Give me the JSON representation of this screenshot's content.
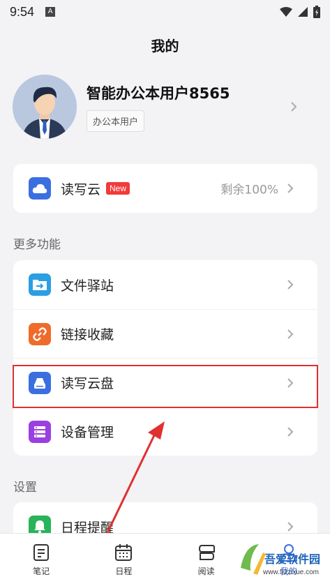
{
  "status_bar": {
    "time": "9:54",
    "notif_glyph": "A"
  },
  "header": {
    "title": "我的"
  },
  "profile": {
    "name": "智能办公本用户8565",
    "tag": "办公本用户"
  },
  "cloud_card": {
    "label": "读写云",
    "badge": "New",
    "value": "剩余100%"
  },
  "more_section": {
    "title": "更多功能",
    "items": [
      {
        "label": "文件驿站",
        "icon": "file-transfer-icon",
        "color": "#2a9fe3"
      },
      {
        "label": "链接收藏",
        "icon": "link-icon",
        "color": "#f06a2a"
      },
      {
        "label": "读写云盘",
        "icon": "cloud-disk-icon",
        "color": "#3b6fe0"
      },
      {
        "label": "设备管理",
        "icon": "device-manage-icon",
        "color": "#9a3fe0"
      }
    ]
  },
  "settings_section": {
    "title": "设置",
    "items": [
      {
        "label": "日程提醒",
        "icon": "reminder-icon",
        "color": "#29b35a"
      }
    ]
  },
  "tabbar": {
    "tabs": [
      {
        "label": "笔记",
        "icon": "notes-icon"
      },
      {
        "label": "日程",
        "icon": "calendar-icon"
      },
      {
        "label": "阅读",
        "icon": "reading-icon"
      },
      {
        "label": "我的",
        "icon": "profile-icon"
      }
    ]
  },
  "watermark": {
    "text": "吾爱软件园",
    "url": "www.52zixue.com"
  },
  "colors": {
    "accent": "#3b6fe0",
    "badge": "#f23a3a",
    "highlight": "#e03030"
  }
}
